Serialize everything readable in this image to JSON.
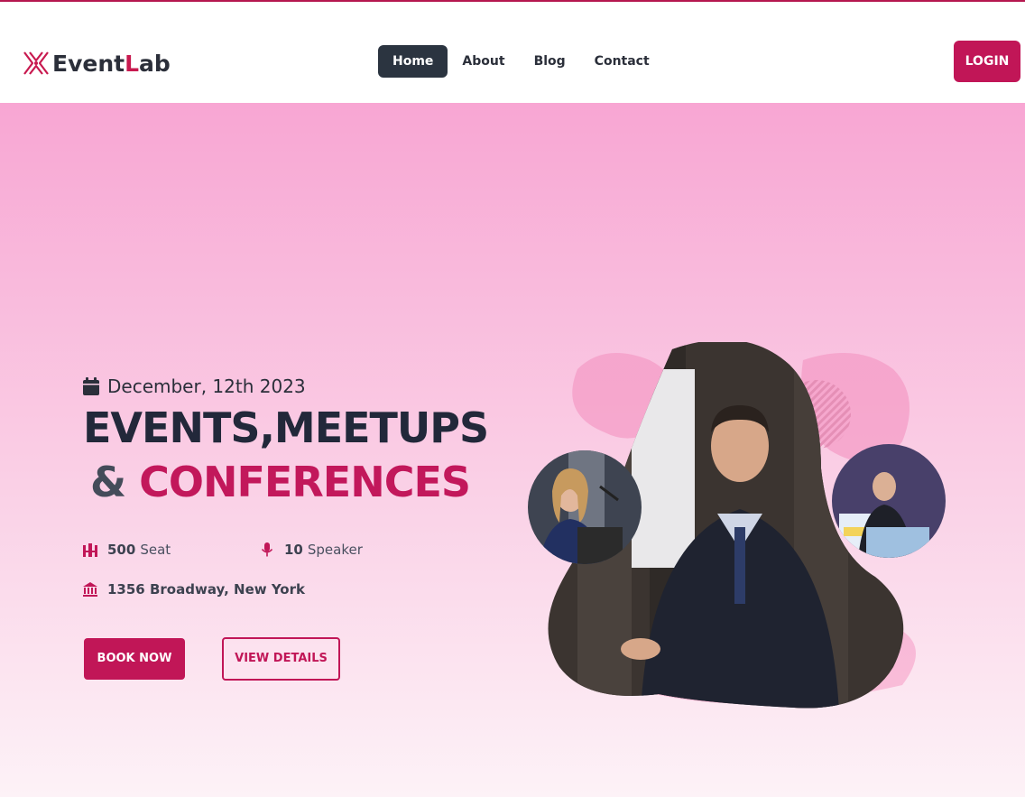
{
  "brand": {
    "name_part1": "Event",
    "name_part2": "L",
    "name_part3": "ab",
    "logo_icon": "eventlab-logo-icon",
    "accent": "#c8194f"
  },
  "nav": {
    "items": [
      {
        "label": "Home",
        "active": true
      },
      {
        "label": "About",
        "active": false
      },
      {
        "label": "Blog",
        "active": false
      },
      {
        "label": "Contact",
        "active": false
      }
    ]
  },
  "login": {
    "label": "LOGIN"
  },
  "hero": {
    "date": "December, 12th 2023",
    "date_icon": "calendar-icon",
    "headline_line1": "EVENTS,MEETUPS",
    "headline_amp": "&",
    "headline_highlight": "CONFERENCES",
    "seats": {
      "value": "500",
      "label": "Seat",
      "icon": "seat-icon"
    },
    "speakers": {
      "value": "10",
      "label": "Speaker",
      "icon": "microphone-icon"
    },
    "address": {
      "text": "1356 Broadway, New York",
      "icon": "venue-building-icon"
    },
    "book_label": "BOOK NOW",
    "view_label": "VIEW DETAILS"
  },
  "colors": {
    "primary": "#c11657",
    "dark": "#2b3440",
    "hero_top": "#f8a6d3",
    "hero_bottom": "#fdf2f7"
  }
}
